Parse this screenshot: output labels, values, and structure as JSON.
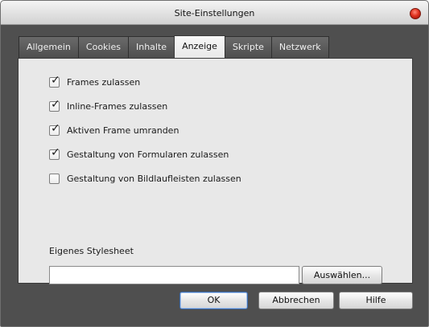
{
  "window": {
    "title": "Site-Einstellungen"
  },
  "tabs": [
    {
      "label": "Allgemein",
      "active": false
    },
    {
      "label": "Cookies",
      "active": false
    },
    {
      "label": "Inhalte",
      "active": false
    },
    {
      "label": "Anzeige",
      "active": true
    },
    {
      "label": "Skripte",
      "active": false
    },
    {
      "label": "Netzwerk",
      "active": false
    }
  ],
  "options": [
    {
      "label": "Frames zulassen",
      "checked": true
    },
    {
      "label": "Inline-Frames zulassen",
      "checked": true
    },
    {
      "label": "Aktiven Frame umranden",
      "checked": true
    },
    {
      "label": "Gestaltung von Formularen zulassen",
      "checked": true
    },
    {
      "label": "Gestaltung von Bildlaufleisten zulassen",
      "checked": false
    }
  ],
  "stylesheet": {
    "label": "Eigenes Stylesheet",
    "value": "",
    "browse_label": "Auswählen..."
  },
  "buttons": {
    "ok": "OK",
    "cancel": "Abbrechen",
    "help": "Hilfe"
  },
  "icons": {
    "close": "close-icon",
    "checkmark": "checkmark-icon"
  },
  "colors": {
    "close_button": "#e0321f",
    "dialog_background": "#4f4f4f",
    "panel_background": "#e8e8e8"
  }
}
